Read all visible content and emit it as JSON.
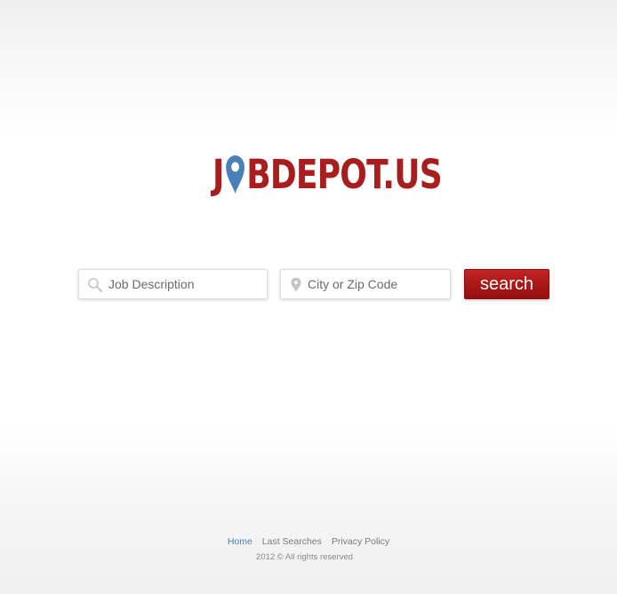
{
  "logo": {
    "before_pin": "J",
    "after_pin": "BDEPOT.US",
    "icon": "map-pin-icon",
    "color": "#a81d1d",
    "pin_color": "#4a7fb8"
  },
  "search": {
    "job_placeholder": "Job Description",
    "job_icon": "search-icon",
    "location_placeholder": "City or Zip Code",
    "location_icon": "location-pin-icon",
    "button_label": "search",
    "button_color": "#a81717"
  },
  "footer": {
    "links": [
      {
        "label": "Home",
        "active": true
      },
      {
        "label": "Last Searches",
        "active": false
      },
      {
        "label": "Privacy Policy",
        "active": false
      }
    ],
    "copyright": "2012 © All rights reserved",
    "active_color": "#4a7fb8"
  }
}
